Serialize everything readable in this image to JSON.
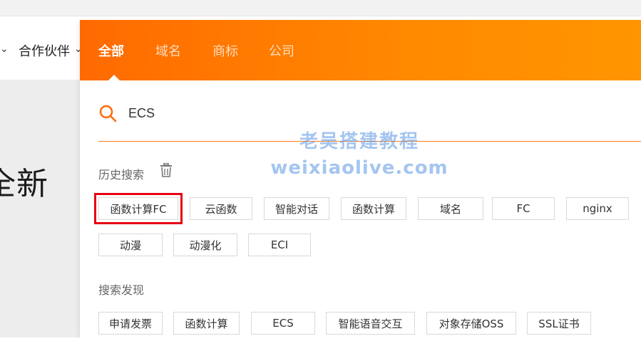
{
  "nav": {
    "partner_label": "合作伙伴"
  },
  "hero": {
    "text": "全新"
  },
  "tabs": [
    {
      "label": "全部",
      "active": true
    },
    {
      "label": "域名",
      "active": false
    },
    {
      "label": "商标",
      "active": false
    },
    {
      "label": "公司",
      "active": false
    }
  ],
  "search": {
    "value": "ECS",
    "icon": "search-icon"
  },
  "watermark": {
    "line1": "老吴搭建教程",
    "line2": "weixiaolive.com"
  },
  "history": {
    "title": "历史搜索",
    "icon": "trash-icon",
    "tags": [
      "函数计算FC",
      "云函数",
      "智能对话",
      "函数计算",
      "域名",
      "FC",
      "nginx",
      "动漫",
      "动漫化",
      "ECI"
    ],
    "highlighted": "函数计算FC"
  },
  "discover": {
    "title": "搜索发现",
    "tags": [
      "申请发票",
      "函数计算",
      "ECS",
      "智能语音交互",
      "对象存储OSS",
      "SSL证书"
    ]
  },
  "colors": {
    "accent": "#ff6a00",
    "highlight": "#e60012"
  }
}
